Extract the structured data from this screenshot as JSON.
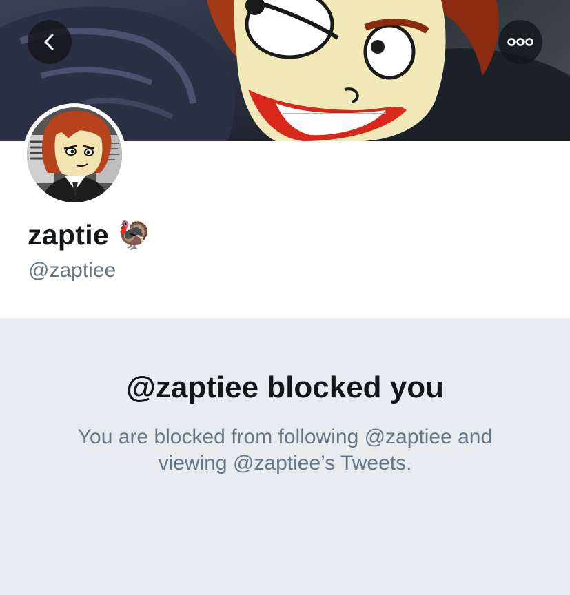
{
  "header": {
    "back_icon": "chevron-left-icon",
    "more_icon": "more-dots-icon"
  },
  "profile": {
    "display_name": "zaptie",
    "name_emoji": "🦃",
    "handle": "@zaptiee"
  },
  "blocked_notice": {
    "title": "@zaptiee blocked you",
    "message": "You are blocked from following @zaptiee and viewing @zaptiee’s Tweets."
  },
  "colors": {
    "panel_bg": "#e6ecf0",
    "primary_text": "#14171a",
    "secondary_text": "#657786"
  }
}
